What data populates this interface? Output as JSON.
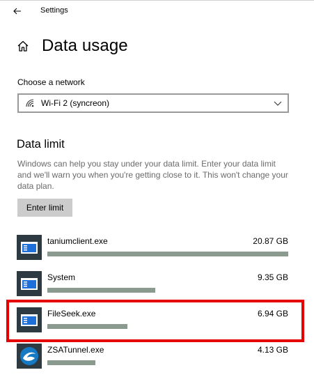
{
  "window": {
    "title": "Settings"
  },
  "page": {
    "title": "Data usage"
  },
  "network": {
    "label": "Choose a network",
    "selected": "Wi-Fi 2 (syncreon)"
  },
  "data_limit": {
    "title": "Data limit",
    "description": "Windows can help you stay under your data limit. Enter your data limit and we'll warn you when you're getting close to it. This won't change your data plan.",
    "button_label": "Enter limit"
  },
  "apps": [
    {
      "name": "taniumclient.exe",
      "usage": "20.87 GB",
      "fraction": 1.0,
      "icon": "app-window-icon"
    },
    {
      "name": "System",
      "usage": "9.35 GB",
      "fraction": 0.448,
      "icon": "app-window-icon"
    },
    {
      "name": "FileSeek.exe",
      "usage": "6.94 GB",
      "fraction": 0.333,
      "icon": "app-window-icon",
      "highlighted": true
    },
    {
      "name": "ZSATunnel.exe",
      "usage": "4.13 GB",
      "fraction": 0.198,
      "icon": "zscaler-icon"
    }
  ],
  "colors": {
    "bar": "#8a9a8e",
    "highlight": "#e60000",
    "button_bg": "#cccccc",
    "app_icon_bg": "#2e3a42"
  }
}
